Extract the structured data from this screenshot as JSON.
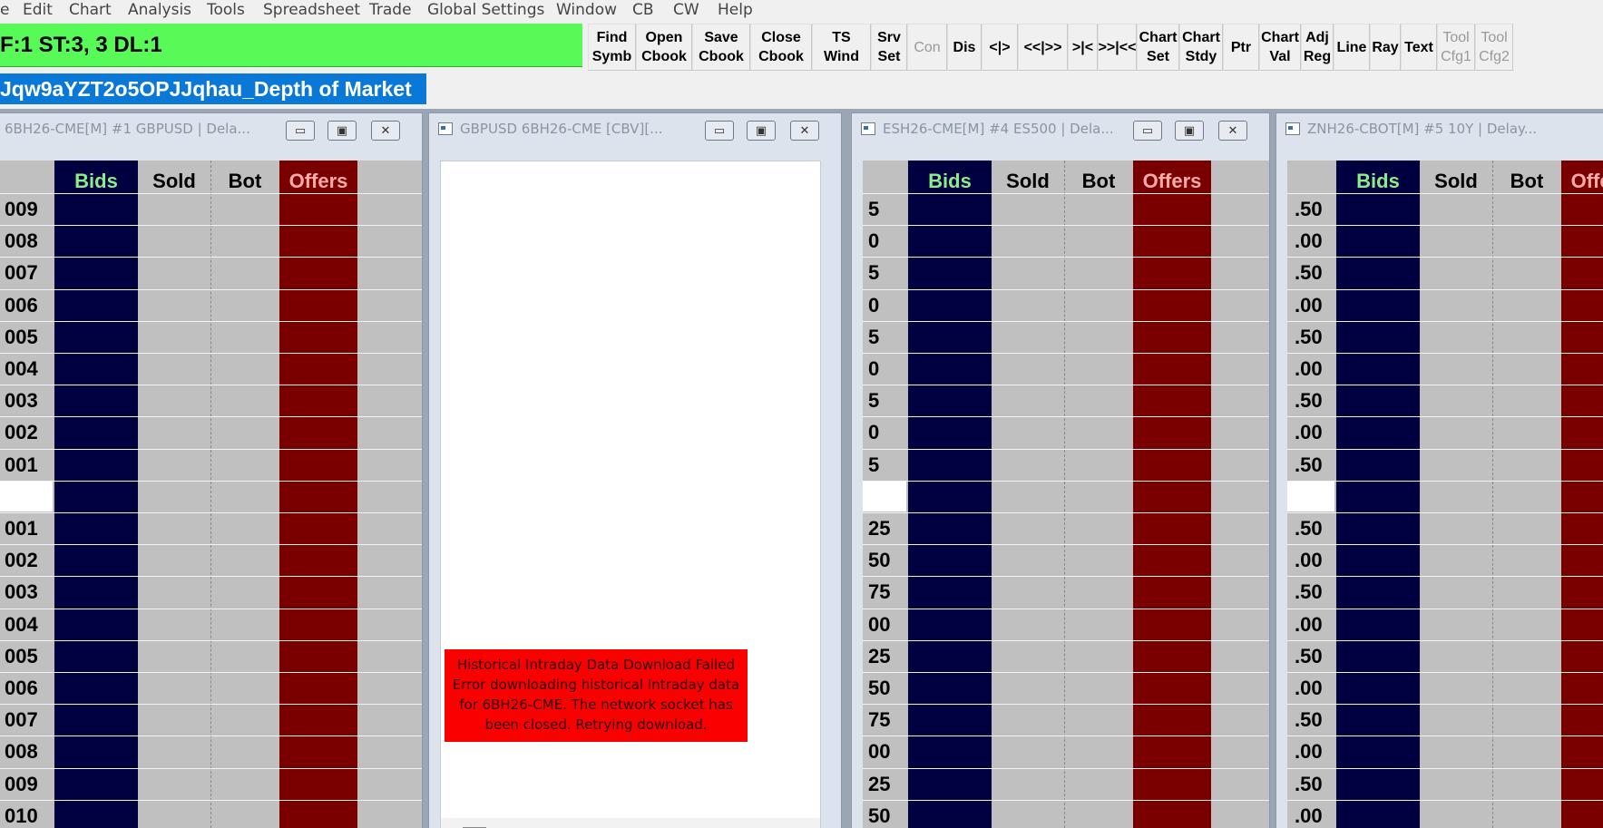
{
  "menu": [
    "e",
    "Edit",
    "Chart",
    "Analysis",
    "Tools",
    "Spreadsheet",
    "Trade",
    "Global Settings",
    "Window",
    "CB",
    "CW",
    "Help"
  ],
  "status": "F:1  ST:3, 3  DL:1",
  "chartbook_tab": "Jqw9aYZT2o5OPJJqhau_Depth of Market",
  "toolbar": [
    {
      "label": "Find\nSymb",
      "dim": false
    },
    {
      "label": "Open\nCbook",
      "dim": false
    },
    {
      "label": "Save\nCbook",
      "dim": false
    },
    {
      "label": "Close\nCbook",
      "dim": false
    },
    {
      "label": "TS\nWind",
      "dim": false
    },
    {
      "label": "Srv\nSet",
      "dim": false
    },
    {
      "label": "Con",
      "dim": true
    },
    {
      "label": "Dis",
      "dim": false
    },
    {
      "label": "<|>",
      "dim": false
    },
    {
      "label": "<<|>>",
      "dim": false
    },
    {
      "label": ">|<",
      "dim": false
    },
    {
      "label": ">>|<<",
      "dim": false
    },
    {
      "label": "Chart\nSet",
      "dim": false
    },
    {
      "label": "Chart\nStdy",
      "dim": false
    },
    {
      "label": "Ptr",
      "dim": false
    },
    {
      "label": "Chart\nVal",
      "dim": false
    },
    {
      "label": "Adj\nReg",
      "dim": false
    },
    {
      "label": "Line",
      "dim": false
    },
    {
      "label": "Ray",
      "dim": false
    },
    {
      "label": "Text",
      "dim": false
    },
    {
      "label": "Tool\nCfg1",
      "dim": true
    },
    {
      "label": "Tool\nCfg2",
      "dim": true
    }
  ],
  "dom_headers": {
    "bids": "Bids",
    "sold": "Sold",
    "bot": "Bot",
    "offers": "Offers"
  },
  "windows": [
    {
      "title": "6BH26-CME[M] #1 GBPUSD | Dela...",
      "prices": [
        "009",
        "008",
        "007",
        "006",
        "005",
        "004",
        "003",
        "002",
        "001",
        "",
        "001",
        "002",
        "003",
        "004",
        "005",
        "006",
        "007",
        "008",
        "009",
        "010"
      ]
    },
    {
      "title": "GBPUSD 6BH26-CME [CBV][...",
      "error": "Historical Intraday Data Download Failed Error downloading historical Intraday data for 6BH26-CME. The network socket has been closed. Retrying download."
    },
    {
      "title": "ESH26-CME[M] #4 ES500 | Dela...",
      "prices": [
        "5",
        "0",
        "5",
        "0",
        "5",
        "0",
        "5",
        "0",
        "5",
        "",
        "25",
        "50",
        "75",
        "00",
        "25",
        "50",
        "75",
        "00",
        "25",
        "50"
      ]
    },
    {
      "title": "ZNH26-CBOT[M] #5 10Y | Delay...",
      "prices": [
        ".50",
        ".00",
        ".50",
        ".00",
        ".50",
        ".00",
        ".50",
        ".00",
        ".50",
        "",
        ".50",
        ".00",
        ".50",
        ".00",
        ".50",
        ".00",
        ".50",
        ".00",
        ".50",
        ".00"
      ]
    }
  ],
  "colors": {
    "status_green": "#58fa58",
    "bids_bg": "#000040",
    "offers_bg": "#7a0000",
    "bids_text": "#88ee88",
    "offers_text": "#ffaaaa",
    "error_red": "#fa0000",
    "tab_blue": "#0a78d7"
  }
}
